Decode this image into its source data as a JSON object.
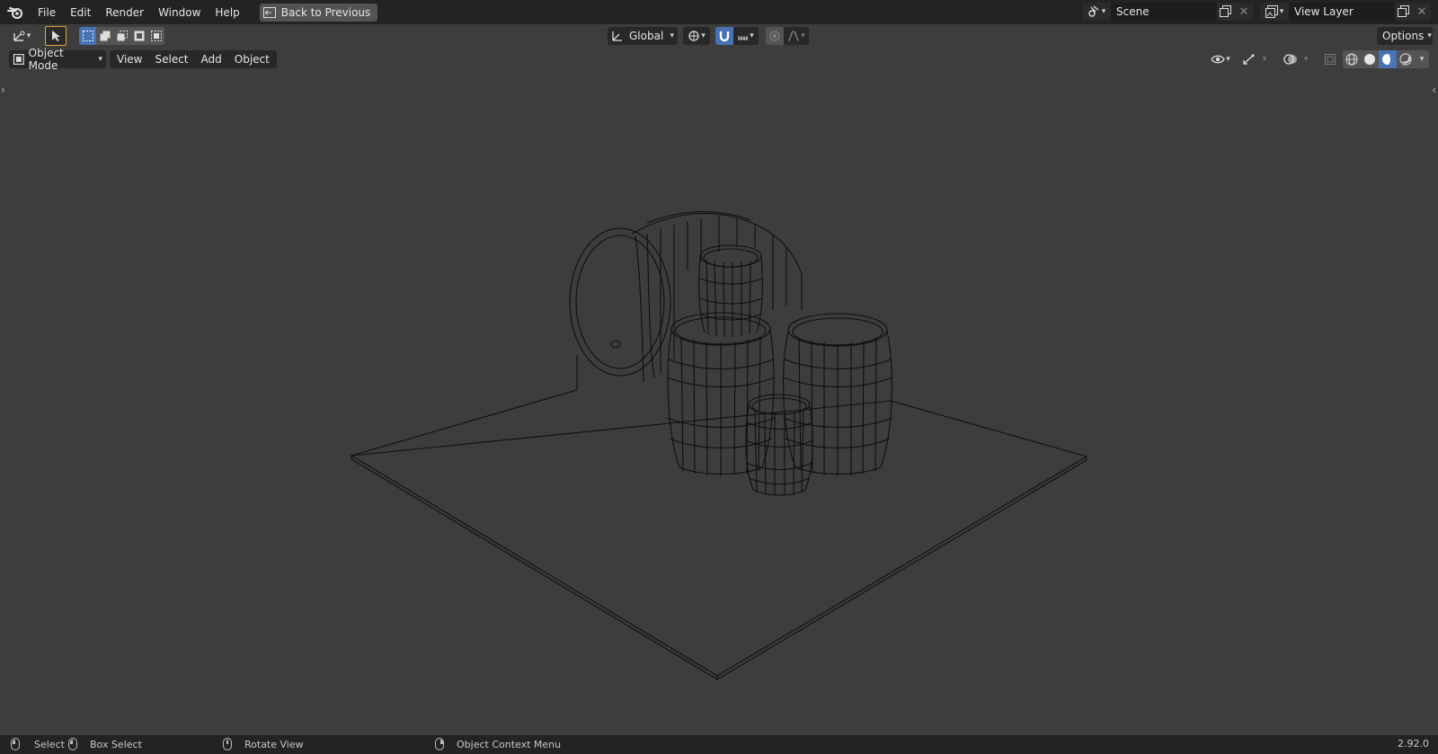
{
  "topbar": {
    "menus": [
      "File",
      "Edit",
      "Render",
      "Window",
      "Help"
    ],
    "back_button": "Back to Previous",
    "scene": {
      "value": "Scene"
    },
    "view_layer": {
      "value": "View Layer"
    }
  },
  "tool_header": {
    "transform_orientation": "Global",
    "options_label": "Options"
  },
  "viewport_header": {
    "mode": "Object Mode",
    "menus": [
      "View",
      "Select",
      "Add",
      "Object"
    ]
  },
  "statusbar": {
    "select": "Select",
    "box_select": "Box Select",
    "rotate_view": "Rotate View",
    "context_menu": "Object Context Menu",
    "version": "2.92.0"
  },
  "colors": {
    "background": "#3d3d3d",
    "wire": "#0f0f0f",
    "accent": "#4772b3",
    "active_tool": "#e8a33d"
  }
}
